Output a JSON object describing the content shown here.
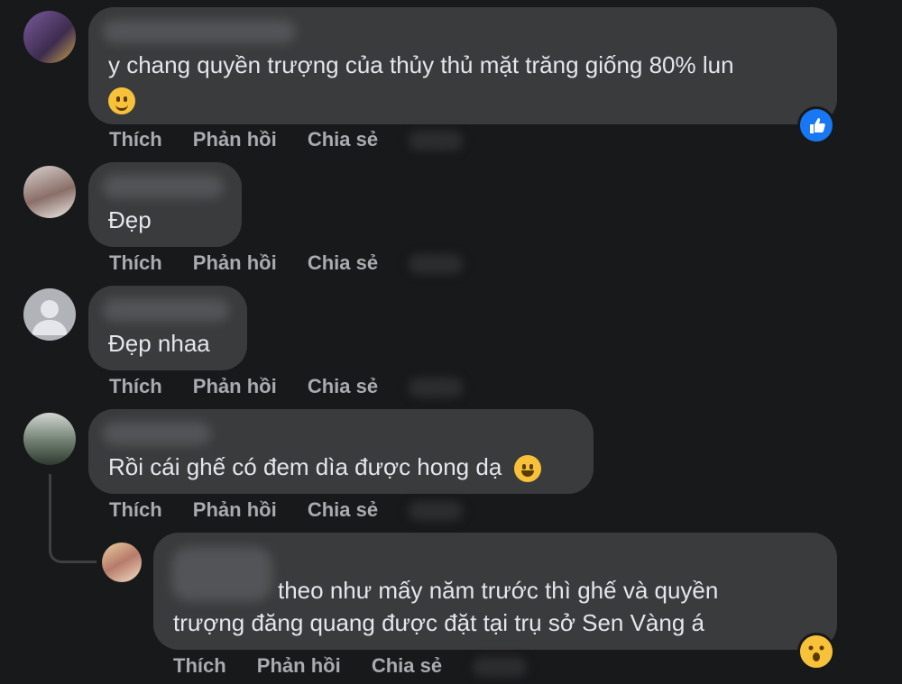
{
  "actions": {
    "like": "Thích",
    "reply": "Phản hồi",
    "share": "Chia sẻ"
  },
  "comments": [
    {
      "text": "y chang quyền trượng của thủy thủ mặt trăng giống 80% lun",
      "reaction": "like-icon"
    },
    {
      "text": "Đẹp"
    },
    {
      "text": "Đẹp nhaa"
    },
    {
      "text": "Rồi cái ghế có đem dìa được hong dạ"
    },
    {
      "text_line1": "theo như mấy năm trước thì ghế và quyền",
      "text_line2": "trượng đăng quang được đặt tại trụ sở Sen Vàng á",
      "reaction": "wow-icon"
    }
  ],
  "colors": {
    "background": "#18191a",
    "bubble": "#3a3b3c",
    "text": "#e4e6eb",
    "action": "#a8abaf",
    "like": "#1877f2"
  }
}
